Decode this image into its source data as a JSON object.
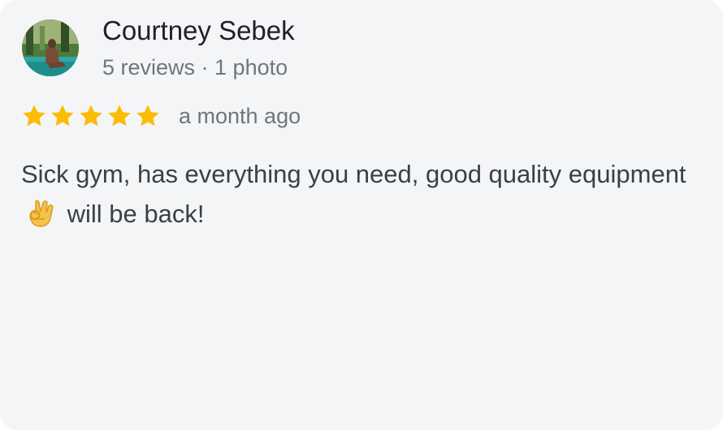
{
  "review": {
    "author_name": "Courtney Sebek",
    "author_meta": "5 reviews · 1 photo",
    "rating": 5,
    "rating_max": 5,
    "date": "a month ago",
    "text_part1": "Sick gym, has everything you need, good quality equipment ",
    "emoji": "ok-hand-emoji",
    "text_part2": " will be back!"
  },
  "colors": {
    "star": "#fbbc04",
    "card_background": "#f4f5f7",
    "name_text": "#202124",
    "secondary_text": "#70757a",
    "body_text": "#3c4043"
  },
  "icons": {
    "avatar": "user-photo",
    "star": "star-icon"
  }
}
